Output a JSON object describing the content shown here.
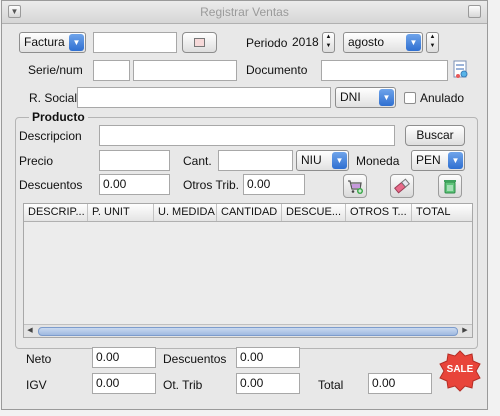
{
  "window": {
    "title": "Registrar Ventas"
  },
  "header": {
    "doc_type": "Factura",
    "periodo_label": "Periodo",
    "year": "2018",
    "month": "agosto",
    "serie_label": "Serie/num",
    "documento_label": "Documento",
    "rsocial_label": "R. Social",
    "doc_id_type": "DNI",
    "anulado_label": "Anulado"
  },
  "producto": {
    "group_title": "Producto",
    "descripcion_label": "Descripcion",
    "buscar_label": "Buscar",
    "precio_label": "Precio",
    "cant_label": "Cant.",
    "unit": "NIU",
    "moneda_label": "Moneda",
    "moneda": "PEN",
    "descuentos_label": "Descuentos",
    "descuentos_value": "0.00",
    "otros_label": "Otros Trib.",
    "otros_value": "0.00"
  },
  "table": {
    "columns": [
      "DESCRIP...",
      "P. UNIT",
      "U. MEDIDA",
      "CANTIDAD",
      "DESCUE...",
      "OTROS T...",
      "TOTAL"
    ]
  },
  "totals": {
    "neto_label": "Neto",
    "neto_value": "0.00",
    "descuentos_label": "Descuentos",
    "descuentos_value": "0.00",
    "igv_label": "IGV",
    "igv_value": "0.00",
    "ottrib_label": "Ot. Trib",
    "ottrib_value": "0.00",
    "total_label": "Total",
    "total_value": "0.00",
    "sale_label": "SALE"
  },
  "colors": {
    "accent": "#2f6fd1",
    "sale": "#e8443a"
  }
}
